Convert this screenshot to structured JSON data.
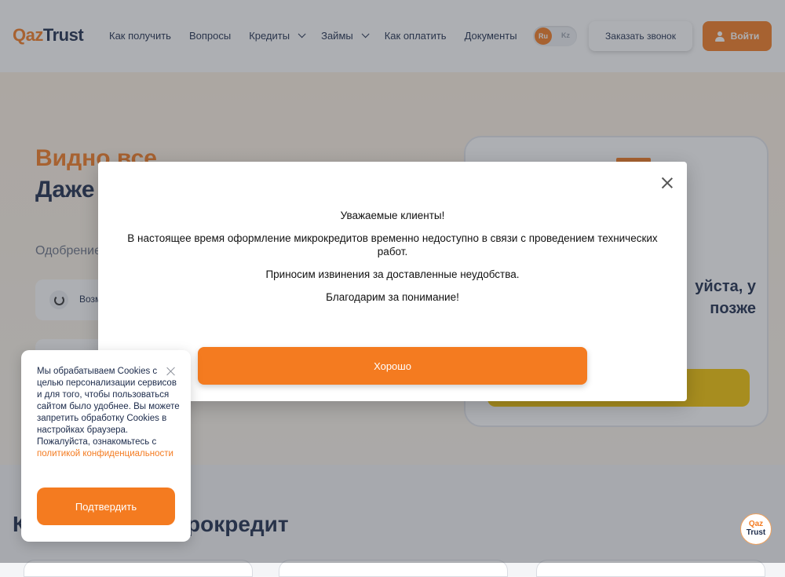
{
  "header": {
    "logo_qaz": "Qaz",
    "logo_trust": "Trust",
    "nav": [
      {
        "label": "Как получить"
      },
      {
        "label": "Вопросы"
      },
      {
        "label": "Кредиты",
        "has_dropdown": true
      },
      {
        "label": "Займы",
        "has_dropdown": true
      },
      {
        "label": "Как оплатить"
      },
      {
        "label": "Документы"
      }
    ],
    "lang_active": "Ru",
    "lang_other": "Kz",
    "callback_label": "Заказать звонок",
    "login_label": "Войти"
  },
  "hero": {
    "title_orange": "Видно все",
    "title_dark": "Даже обычн",
    "subtitle": "Одобрение",
    "feature_label": "Возм",
    "card_text": "уйста, у позже"
  },
  "section": {
    "title_start": "К",
    "title_end": "рокредит"
  },
  "modal": {
    "line1": "Уважаемые клиенты!",
    "line2": "В настоящее время оформление микрокредитов временно недоступно в связи с проведением технических работ.",
    "line3": "Приносим извинения за доставленные неудобства.",
    "line4": "Благодарим за понимание!",
    "ok_label": "Хорошо"
  },
  "cookie": {
    "text": "Мы обрабатываем Cookies с целью персонализации сервисов и для того, чтобы пользоваться сайтом было удобнее. Вы можете запретить обработку Cookies в настройках браузера. Пожалуйста, ознакомьтесь с ",
    "link_text": "политикой конфиденциальности",
    "confirm_label": "Подтвердить"
  },
  "fab": {
    "line1": "Qaz",
    "line2": "Trust"
  },
  "colors": {
    "accent": "#f47b20",
    "dark": "#1b2a4a",
    "card_button": "#f5c400"
  }
}
